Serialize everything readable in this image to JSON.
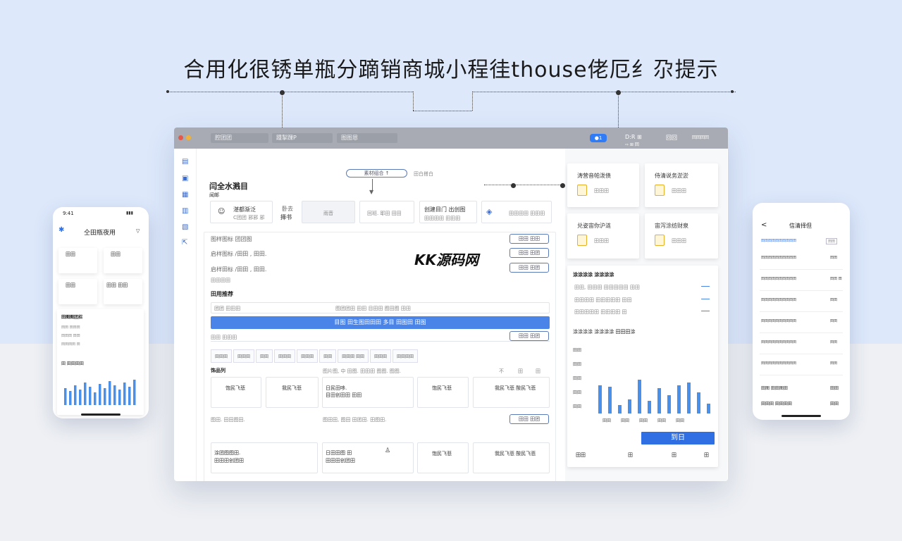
{
  "page": {
    "title": "合用化很锈单瓶分蹢销商城小程徍thouse佬厄纟尕提示"
  },
  "window": {
    "address": [
      "腔团团",
      "踵掣踝P",
      "图图恩"
    ],
    "badge": "●1",
    "top_right": [
      "D:R ⊞",
      "⇨ ⊞ 回",
      "⊞",
      "回回",
      "回回回回"
    ]
  },
  "sidebar": {
    "icons": [
      "doc-icon",
      "cart-icon",
      "calendar-icon",
      "list-icon",
      "book-icon",
      "share-icon"
    ]
  },
  "main": {
    "step_pill": "素材组合 ↑",
    "step_side": "田白搭白",
    "heading": "闫全水溅目",
    "heading_sub": "闻邮",
    "summary_box": {
      "icon": "user-icon",
      "title": "湛都渐泛",
      "sub": "C团团 邪邪 邪"
    },
    "summary_label": [
      "卧去",
      "择书"
    ],
    "box2": "雨音",
    "box3": "回班. 耶田 田田",
    "box4": {
      "title": "创建目门 出创图",
      "sub": "田田田田 田田田"
    },
    "box5": "田田田田 田田田",
    "rows": [
      "图样图标 团团图",
      "启样图标 /田田 , 田田.",
      "启样田标 /田田 , 田田."
    ],
    "row_buttons": [
      "田田 田田",
      "田田 田团",
      "田田 田团"
    ],
    "section_title": "田用推荐",
    "form_left": "团团 田田田",
    "form_mid": "图团团田 田田 目田田 图田图 田田",
    "blue_button": "目图 田生图田田田      多目 田图田 田图",
    "secondary_row": "田田 田田田",
    "secondary_btn": "田田 田团",
    "tabs": [
      "田田田",
      "田田田",
      "田田",
      "田田田",
      "田田田",
      "田田",
      "田田田 田田",
      "田田田",
      "田田田田"
    ],
    "list_title": "饰品列",
    "list_header": [
      "图片图, 中 田图. 田田田 图图. 图图.",
      "不",
      "田",
      "田"
    ],
    "cards_row1": [
      "饱民飞悲",
      "我民飞悲",
      "日民田哆.",
      "饱民飞悲",
      "我民飞悲   酸民飞悲"
    ],
    "cards_row1_sub": [
      "",
      "",
      "目田创田田 田田",
      "",
      ""
    ],
    "row2_text": "图田. 田田图田.",
    "row2_text2": "图田田, 图田 田团田. 田图田.",
    "row2_btn": "田田 田团",
    "cards_row2": [
      "涂团图图田.",
      "日田田图 田",
      "饱民飞悲",
      "我民飞悲    酸民飞悲"
    ],
    "cards_row2_sub": [
      "田田田创团田",
      "田田田创团田",
      "",
      ""
    ]
  },
  "right_panel": {
    "cards": [
      {
        "title": "涛营音帕泼债",
        "sub": "田田田"
      },
      {
        "title": "侍清说务淤淤",
        "sub": "田田田"
      },
      {
        "title": "兑姿宙你沪涟",
        "sub": "田田田"
      },
      {
        "title": "宙泻涂纺财泉",
        "sub": "田田田"
      }
    ],
    "section1_title": "涂涂涂涂 涂涂涂涂",
    "section1_rows": [
      "田田, 田田田 田田田田田 田田",
      "田田田田 田田田田田 田田",
      "田田田田田 田田田田 田"
    ],
    "section2_title": "涂涂涂涂 涂涂涂涂 田田田涂",
    "chart_legend": [
      "田田 田图",
      "田田",
      "田田"
    ],
    "y_labels": [
      "田田",
      "田田",
      "田田",
      "田田",
      "田田"
    ],
    "x_labels": [
      "田田",
      "田田",
      "田田",
      "田田",
      "田田"
    ],
    "submit": "到日",
    "footer": [
      "田田",
      "田",
      "田",
      "田"
    ]
  },
  "phone_left": {
    "time": "9:41",
    "title": "仝田瓶夜用",
    "tiles": [
      "田田",
      "田田",
      "田田",
      "田田 田田"
    ],
    "section": "田图图团招",
    "rows": [
      "田田 田田田",
      "田田田 田田",
      "田田田田 田"
    ],
    "chart_title": "田 田田田田",
    "bar_values": [
      12,
      10,
      14,
      11,
      16,
      13,
      9,
      15,
      12,
      17,
      14,
      11,
      16,
      13,
      18
    ]
  },
  "phone_right": {
    "title": "信清择但",
    "back": "<",
    "header_left": "田田田田田田田田田田",
    "header_right": "田田",
    "rows": [
      {
        "left": "田田田田田田田田田田",
        "right": "田田"
      },
      {
        "left": "田田田田田田田田田田",
        "right": "田田 田"
      },
      {
        "left": "田田田田田田田田田田",
        "right": "田田"
      },
      {
        "left": "田田田田田田田田田田",
        "right": "田田"
      },
      {
        "left": "田田田田田田田田田田",
        "right": "田田"
      },
      {
        "left": "田田田田田田田田田田",
        "right": "田田"
      }
    ],
    "footer_rows": [
      {
        "left": "田图 田田图田",
        "right": "田田"
      },
      {
        "left": "田田田 田田田田",
        "right": "田田"
      }
    ]
  },
  "watermark": "KK源码网"
}
